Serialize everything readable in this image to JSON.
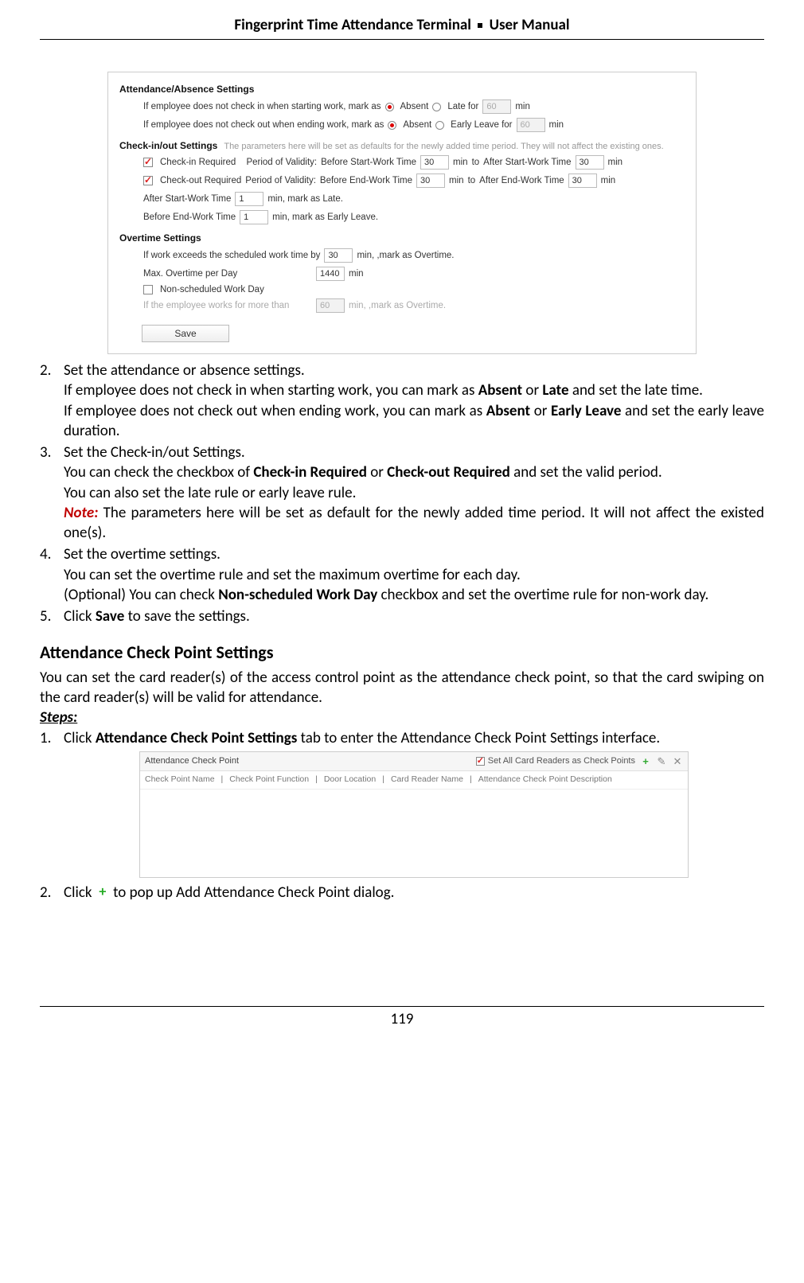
{
  "header": {
    "left": "Fingerprint Time Attendance Terminal",
    "right": "User Manual"
  },
  "panel1": {
    "sect_attendance": "Attendance/Absence Settings",
    "row_start_label": "If employee does not check in when starting work, mark as",
    "opt_absent": "Absent",
    "opt_late": "Late for",
    "val_late": "60",
    "unit_min": "min",
    "row_end_label": "If employee does not check out when ending work, mark as",
    "opt_early": "Early Leave for",
    "val_early": "60",
    "sect_check": "Check-in/out Settings",
    "check_hint": "The parameters here will be set as defaults for the newly added time period. They will not affect the existing ones.",
    "chk_in": "Check-in Required",
    "pov": "Period of Validity:",
    "before_start": "Before Start-Work Time",
    "after_start": "After Start-Work Time",
    "chk_out": "Check-out Required",
    "before_end": "Before End-Work Time",
    "after_end": "After End-Work Time",
    "to": "to",
    "v30": "30",
    "after_start2": "After Start-Work Time",
    "v1": "1",
    "mark_late": "min,  mark as Late.",
    "before_end2": "Before End-Work Time",
    "mark_early": "min,  mark as Early Leave.",
    "sect_ot": "Overtime Settings",
    "ot_exceed": "If work exceeds the scheduled work time by",
    "ot_mark": "min,  ,mark as Overtime.",
    "max_ot": "Max. Overtime per Day",
    "v1440": "1440",
    "nonsched": "Non-scheduled Work Day",
    "ifmore": "If the employee works for more than",
    "ot_mark2": "min,  ,mark as Overtime.",
    "save": "Save"
  },
  "body": {
    "li2_a": "Set the attendance or absence settings.",
    "li2_b1": "If employee does not check in when starting work, you can mark as ",
    "li2_b_absent": "Absent",
    "li2_b_or": " or ",
    "li2_b_late": "Late",
    "li2_b2": " and set the late time.",
    "li2_c1": "If employee does not check out when ending work, you can mark as ",
    "li2_c_early": "Early Leave",
    "li2_c2": " and set the early leave duration.",
    "li3_a": "Set the Check-in/out Settings.",
    "li3_b1": "You can check the checkbox of ",
    "li3_b_ci": "Check-in Required",
    "li3_b_or": " or ",
    "li3_b_co": "Check-out Required",
    "li3_b2": " and set the valid period.",
    "li3_c": "You can also set the late rule or early leave rule.",
    "li3_note": "Note:",
    "li3_d": " The parameters here will be set as default for the newly added time period. It will not affect the existed one(s).",
    "li4_a": "Set the overtime settings.",
    "li4_b": "You can set the overtime rule and set the maximum overtime for each day.",
    "li4_c1": "(Optional) You can check ",
    "li4_c_ns": "Non-scheduled Work Day",
    "li4_c2": " checkbox and set the overtime rule for non-work day.",
    "li5_a1": "Click ",
    "li5_save": "Save",
    "li5_a2": " to save the settings.",
    "h3": "Attendance Check Point Settings",
    "p_intro": "You can set the card reader(s) of the access control point as the attendance check point, so that the card swiping on the card reader(s) will be valid for attendance.",
    "steps": "Steps:",
    "s1_a1": "Click ",
    "s1_b": "Attendance Check Point Settings",
    "s1_a2": " tab to enter the Attendance Check Point Settings interface.",
    "s2_a1": "Click ",
    "s2_a2": " to pop up Add Attendance Check Point dialog."
  },
  "panel2": {
    "title": "Attendance Check Point",
    "setall": "Set All Card Readers as Check Points",
    "col1": "Check Point Name",
    "col2": "Check Point Function",
    "col3": "Door Location",
    "col4": "Card Reader Name",
    "col5": "Attendance Check Point Description"
  },
  "footer": "119"
}
